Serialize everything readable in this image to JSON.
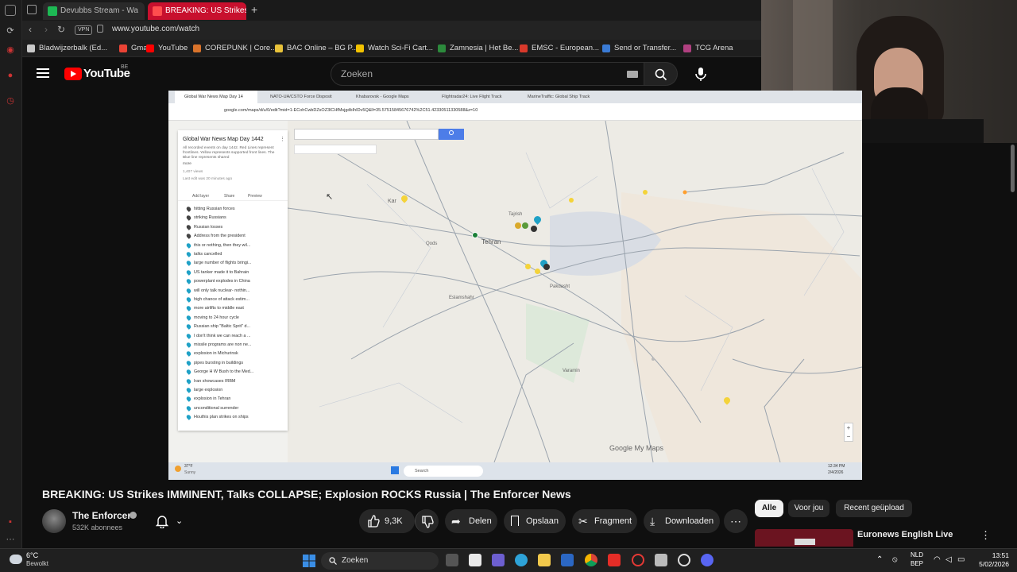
{
  "browser": {
    "tabs": [
      {
        "label": "Devubbs Stream - Wa",
        "active": false
      },
      {
        "label": "BREAKING: US Strikes",
        "active": true
      }
    ],
    "vpn_label": "VPN",
    "url": "www.youtube.com/watch",
    "bookmarks": [
      {
        "label": "Bladwijzerbalk (Ed...",
        "color": "#c9c9c9"
      },
      {
        "label": "Gmail",
        "color": "#ea4335"
      },
      {
        "label": "YouTube",
        "color": "#ff0000"
      },
      {
        "label": "COREPUNK | Core...",
        "color": "#d9732b"
      },
      {
        "label": "BAC Online – BG P...",
        "color": "#e8c23a"
      },
      {
        "label": "Watch Sci-Fi Cart...",
        "color": "#f2c200"
      },
      {
        "label": "Zamnesia | Het Be...",
        "color": "#2c8a3c"
      },
      {
        "label": "EMSC - European...",
        "color": "#d8392b"
      },
      {
        "label": "Send or Transfer...",
        "color": "#3a7bd5"
      },
      {
        "label": "TCG Arena",
        "color": "#b04080"
      }
    ]
  },
  "youtube": {
    "logo_text": "YouTube",
    "region": "BE",
    "search_placeholder": "Zoeken",
    "video": {
      "title": "BREAKING: US Strikes IMMINENT, Talks COLLAPSE; Explosion ROCKS Russia | The Enforcer News",
      "channel": "The Enforcer",
      "subscribers": "532K abonnees",
      "likes": "9,3K",
      "share": "Delen",
      "save": "Opslaan",
      "clip": "Fragment",
      "download": "Downloaden"
    },
    "filter_chips": [
      "Alle",
      "Voor jou",
      "Recent geüpload"
    ],
    "recommended": {
      "channel_title": "Euronews English Live"
    }
  },
  "embedded": {
    "tabs": [
      "Global War News Map Day 14",
      "NATO-UA/CSTO Force Disposit",
      "Khabarovsk - Google Maps",
      "Flightradar24: Live Flight Track",
      "MarineTraffic: Global Ship Track"
    ],
    "url": "google.com/maps/d/u/0/edit?mid=1-ECohCwbDZsOZ3lCHfMsjgdbIhIDv5Q&ll=35.57515845676742%2C51.42330511330588&z=10",
    "panel_title": "Global War News Map Day 1442",
    "panel_desc": "All recorded events on day 1442. Red Lines represent frontlines. Yellow represents supported front lines. The Blue line represents shared",
    "panel_more": "more",
    "panel_views": "1,407 views",
    "panel_edited": "Last edit was 20 minutes ago",
    "panel_actions": [
      "Add layer",
      "Share",
      "Preview"
    ],
    "layers": [
      "hitting Russian forces",
      "striking Russians",
      "Russian losses",
      "Address from the president",
      "this or nothing, then they wil...",
      "talks cancelled",
      "large number of flights bringi...",
      "US tanker made it to Bahrain",
      "powerplant explodes in China",
      "will only talk nuclear- nothin...",
      "high chance of attack estim...",
      "more airlifts to middle east",
      "moving to 24 hour cycle",
      "Russian ship \"Baltic Sprit\" d...",
      "I don't think we can reach a ...",
      "missile programs are non ne...",
      "explosion in Michurinsk",
      "pipes bursting in buildings",
      "George H W Bush to the Med...",
      "Iran showcases IRBM",
      "large explosion",
      "explosion in Tehran",
      "unconditional surrender",
      "Houthis plan strikes on ships"
    ],
    "map_labels": [
      "Kar",
      "Tehran",
      "Tajrish",
      "Qods",
      "Eslamshahr",
      "Varamin",
      "Pakdasht"
    ],
    "map_brand": "Google My Maps",
    "weather": "37°F",
    "weather_desc": "Sunny",
    "search_label": "Search",
    "clock": "12:34 PM",
    "date": "2/4/2026"
  },
  "taskbar": {
    "weather_temp": "6°C",
    "weather_desc": "Bewolkt",
    "search": "Zoeken",
    "lang1": "NLD",
    "lang2": "BEP",
    "time": "13:51",
    "date": "5/02/2026"
  }
}
